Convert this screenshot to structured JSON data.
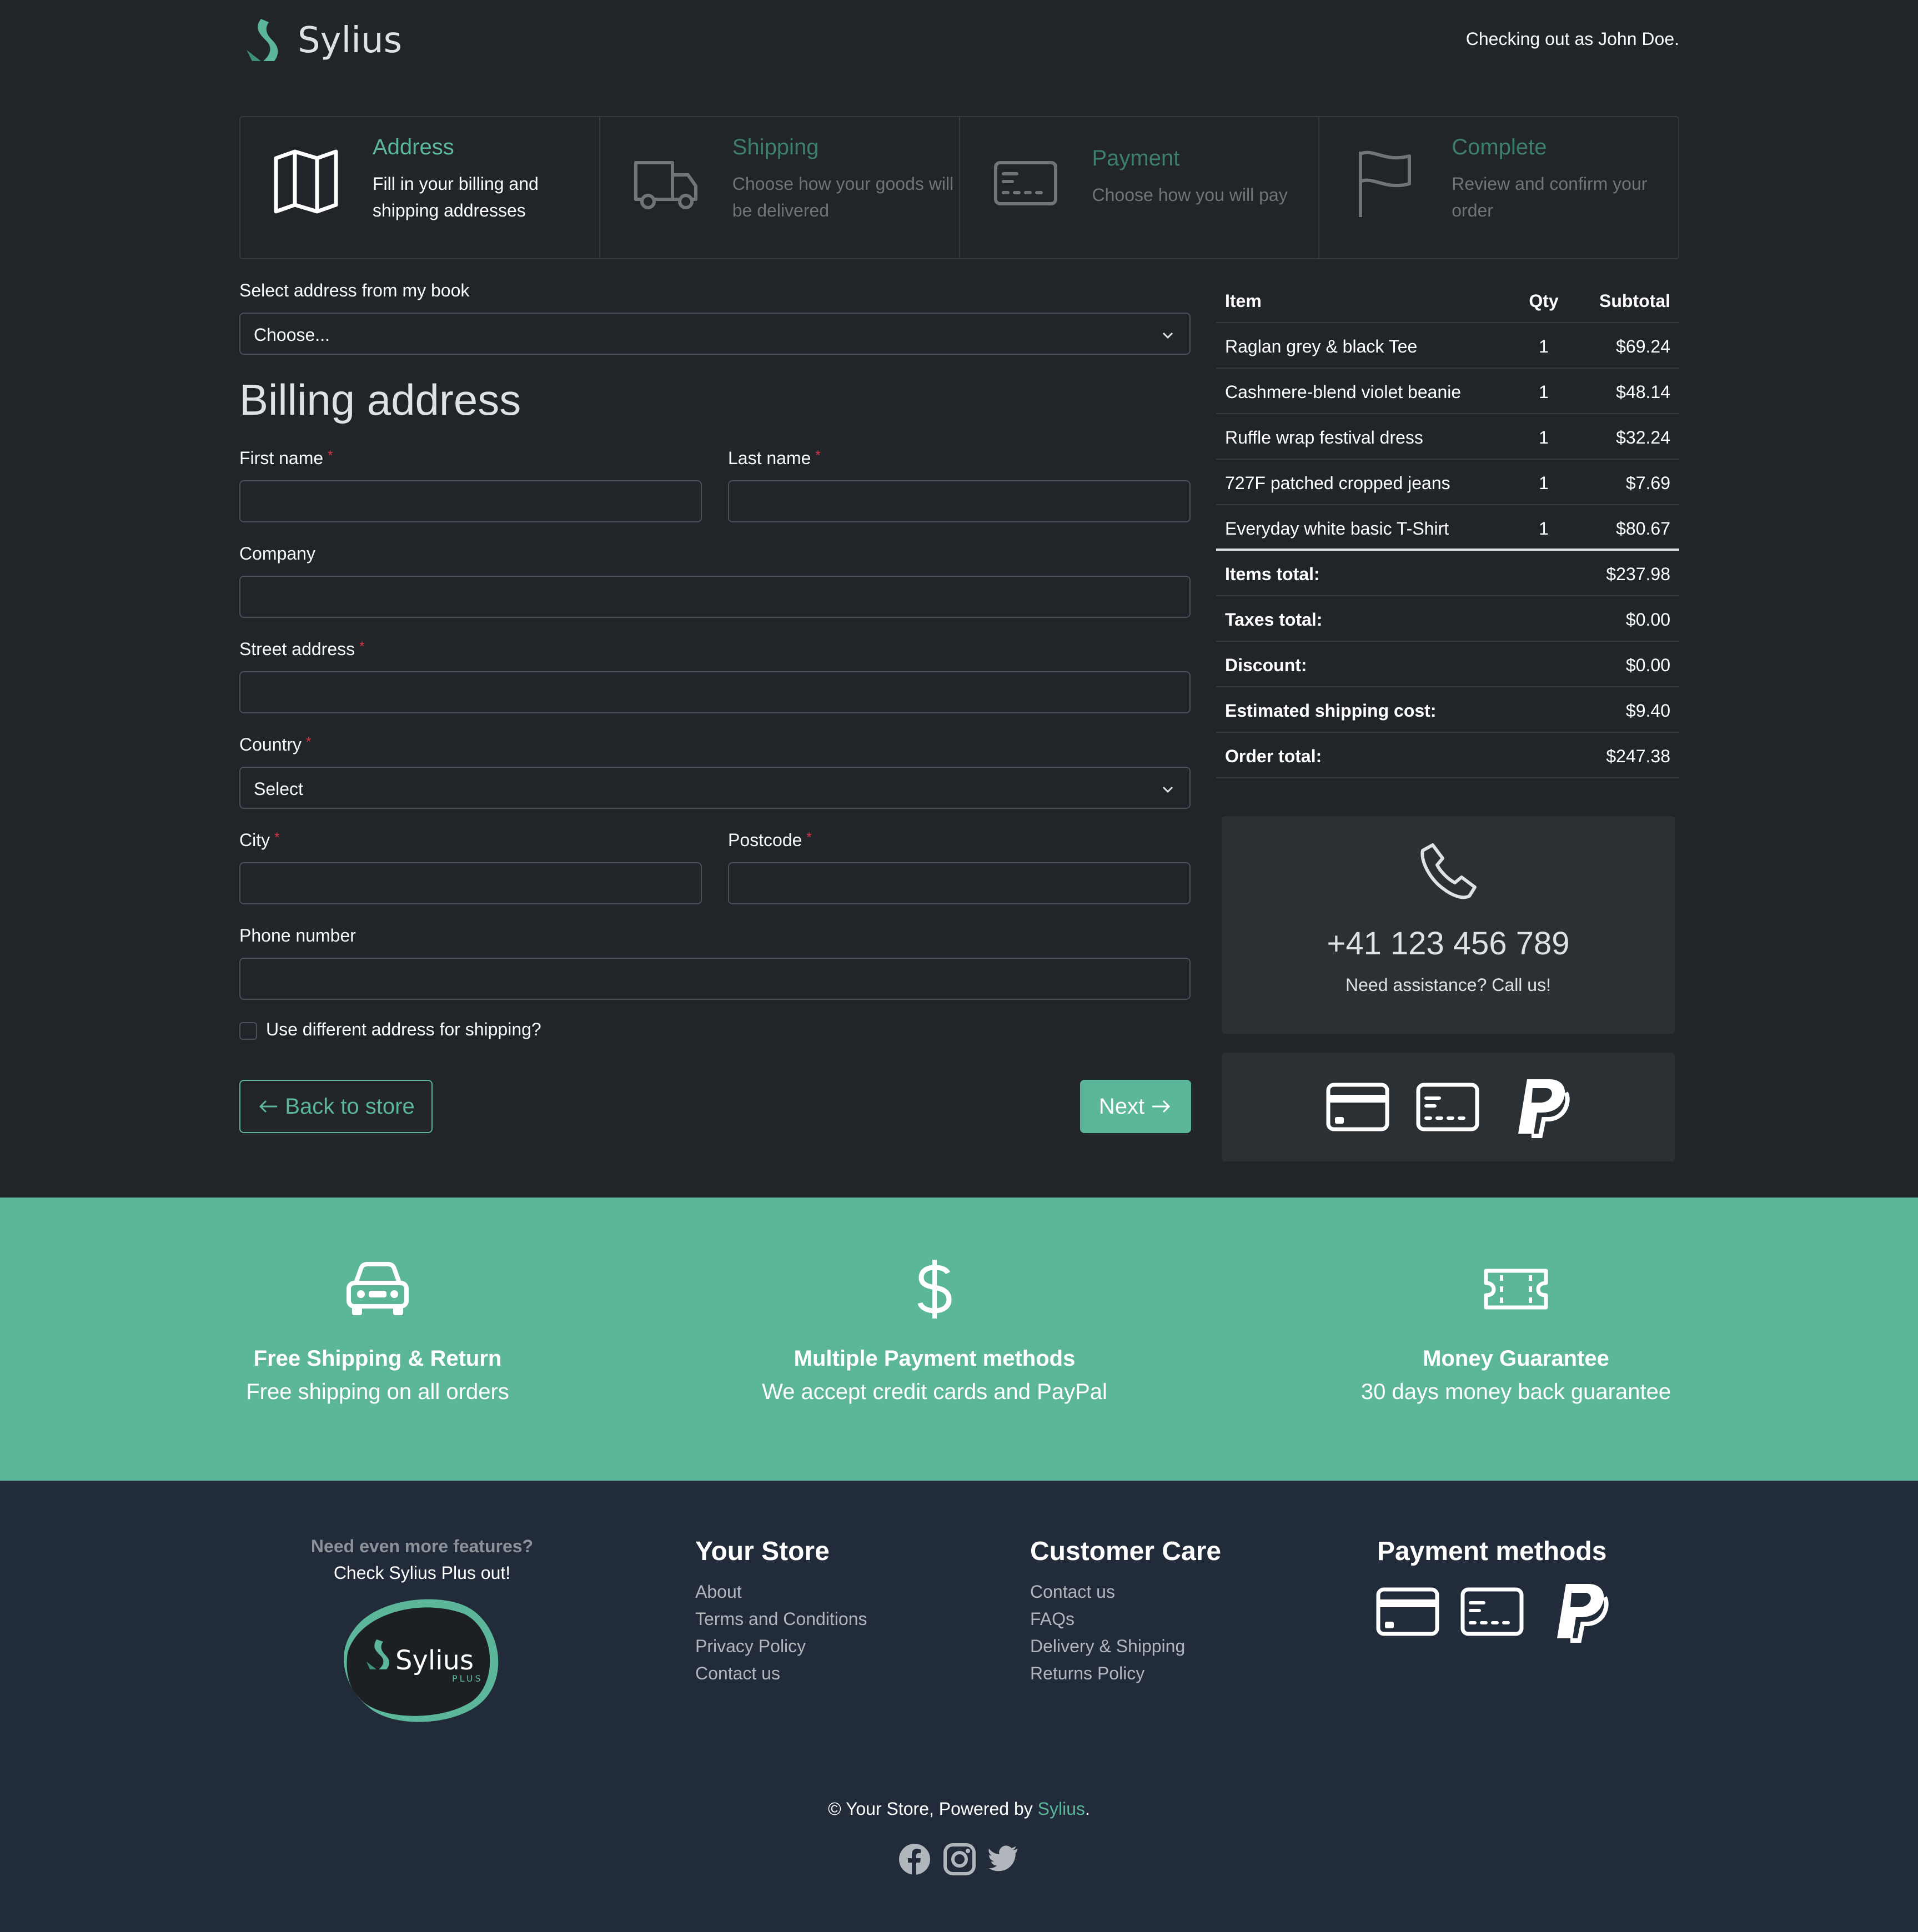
{
  "header": {
    "logo_text": "Sylius",
    "checking_out": "Checking out as John Doe."
  },
  "steps": [
    {
      "title": "Address",
      "desc": "Fill in your billing and shipping addresses",
      "icon": "map-icon",
      "active": true
    },
    {
      "title": "Shipping",
      "desc": "Choose how your goods will be delivered",
      "icon": "truck-icon",
      "active": false
    },
    {
      "title": "Payment",
      "desc": "Choose how you will pay",
      "icon": "payment-card-icon",
      "active": false
    },
    {
      "title": "Complete",
      "desc": "Review and confirm your order",
      "icon": "flag-icon",
      "active": false
    }
  ],
  "form": {
    "address_book_label": "Select address from my book",
    "address_book_value": "Choose...",
    "billing_title": "Billing address",
    "first_name_label": "First name",
    "last_name_label": "Last name",
    "company_label": "Company",
    "street_label": "Street address",
    "country_label": "Country",
    "country_value": "Select",
    "city_label": "City",
    "postcode_label": "Postcode",
    "phone_label": "Phone number",
    "required_mark": "*",
    "different_shipping_label": "Use different address for shipping?",
    "back_label": "Back to store",
    "next_label": "Next"
  },
  "summary": {
    "headers": {
      "item": "Item",
      "qty": "Qty",
      "subtotal": "Subtotal"
    },
    "items": [
      {
        "name": "Raglan grey & black Tee",
        "qty": "1",
        "subtotal": "$69.24"
      },
      {
        "name": "Cashmere-blend violet beanie",
        "qty": "1",
        "subtotal": "$48.14"
      },
      {
        "name": "Ruffle wrap festival dress",
        "qty": "1",
        "subtotal": "$32.24"
      },
      {
        "name": "727F patched cropped jeans",
        "qty": "1",
        "subtotal": "$7.69"
      },
      {
        "name": "Everyday white basic T-Shirt",
        "qty": "1",
        "subtotal": "$80.67"
      }
    ],
    "totals": [
      {
        "label": "Items total:",
        "value": "$237.98"
      },
      {
        "label": "Taxes total:",
        "value": "$0.00"
      },
      {
        "label": "Discount:",
        "value": "$0.00"
      },
      {
        "label": "Estimated shipping cost:",
        "value": "$9.40"
      },
      {
        "label": "Order total:",
        "value": "$247.38"
      }
    ]
  },
  "assistance": {
    "phone": "+41 123 456 789",
    "text": "Need assistance? Call us!"
  },
  "features": [
    {
      "icon": "car-icon",
      "title": "Free Shipping & Return",
      "desc": "Free shipping on all orders"
    },
    {
      "icon": "dollar-icon",
      "title": "Multiple Payment methods",
      "desc": "We accept credit cards and PayPal"
    },
    {
      "icon": "ticket-icon",
      "title": "Money Guarantee",
      "desc": "30 days money back guarantee"
    }
  ],
  "footer": {
    "promo_question": "Need even more features?",
    "promo_answer": "Check Sylius Plus out!",
    "promo_logo_text": "Sylius",
    "promo_logo_sub": "PLUS",
    "your_store_title": "Your Store",
    "your_store_links": [
      "About",
      "Terms and Conditions",
      "Privacy Policy",
      "Contact us"
    ],
    "customer_care_title": "Customer Care",
    "customer_care_links": [
      "Contact us",
      "FAQs",
      "Delivery & Shipping",
      "Returns Policy"
    ],
    "payment_methods_title": "Payment methods",
    "copyright_prefix": "© Your Store, Powered by",
    "copyright_brand": "Sylius",
    "copyright_suffix": ".",
    "social": [
      "facebook-icon",
      "instagram-icon",
      "twitter-icon"
    ]
  },
  "colors": {
    "accent": "#5cb699",
    "background": "#212529",
    "footer_bg": "#212b39",
    "panel_bg": "#2b3035"
  }
}
